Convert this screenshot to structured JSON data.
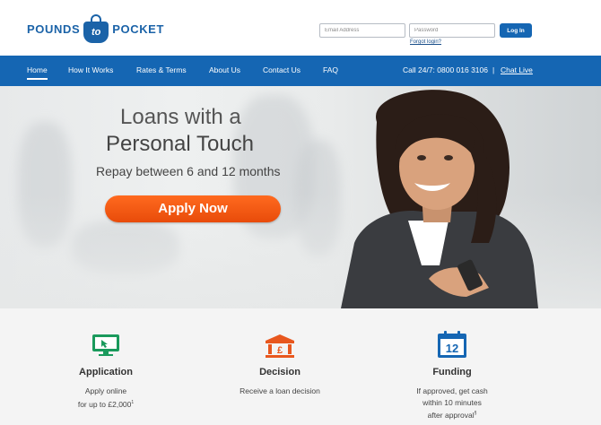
{
  "brand": {
    "left": "POUNDS",
    "middle": "to",
    "right": "POCKET"
  },
  "login": {
    "email_placeholder": "Email Address",
    "password_placeholder": "Password",
    "button": "Log In",
    "forgot": "Forgot login?"
  },
  "nav": {
    "items": [
      {
        "label": "Home",
        "active": true
      },
      {
        "label": "How It Works"
      },
      {
        "label": "Rates & Terms"
      },
      {
        "label": "About Us"
      },
      {
        "label": "Contact Us"
      },
      {
        "label": "FAQ"
      }
    ],
    "phone": "Call 24/7: 0800 016 3106",
    "separator": "|",
    "chat": "Chat Live"
  },
  "hero": {
    "title_line1": "Loans with a",
    "title_line2": "Personal Touch",
    "subtitle": "Repay between 6 and 12 months",
    "cta": "Apply Now"
  },
  "features": [
    {
      "icon": "monitor-icon",
      "title": "Application",
      "line1": "Apply online",
      "line2": "for up to £2,000",
      "sup": "1"
    },
    {
      "icon": "bank-icon",
      "title": "Decision",
      "line1": "Receive a loan decision"
    },
    {
      "icon": "calendar-icon",
      "icon_text": "12",
      "title": "Funding",
      "line1": "If approved, get cash",
      "line2": "within 10 minutes",
      "line3": "after approval",
      "sup": "§"
    }
  ],
  "colors": {
    "brand_blue": "#1566b3",
    "cta_orange": "#f05a14",
    "icon_green": "#1a9a5c",
    "icon_orange": "#e8571e",
    "icon_blue": "#1566b3"
  }
}
